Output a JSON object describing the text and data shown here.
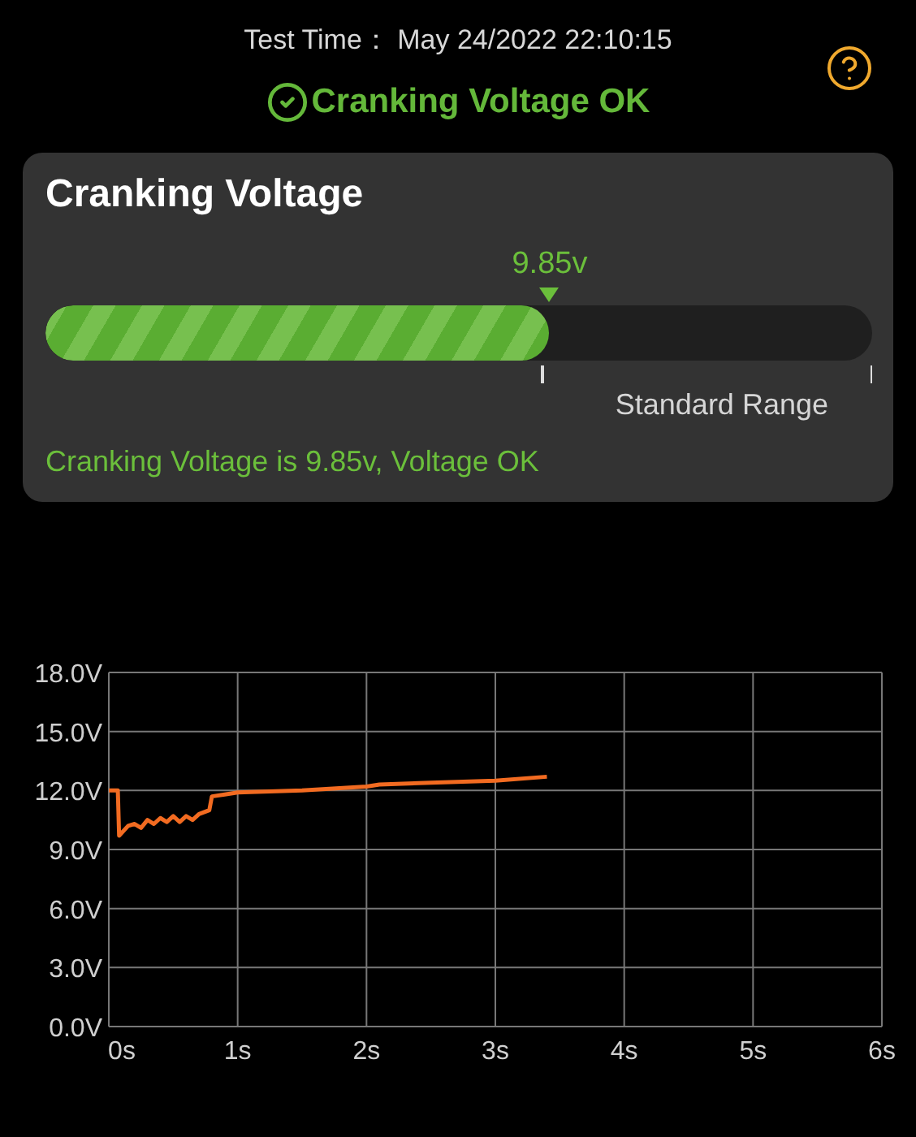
{
  "header": {
    "test_time": "Test Time： May 24/2022 22:10:15",
    "status": {
      "kind": "ok",
      "text": "Cranking Voltage OK"
    }
  },
  "card": {
    "title": "Cranking Voltage",
    "reading": "9.85v",
    "level": 0.61,
    "range_label": "Standard Range",
    "message": "Cranking Voltage is 9.85v, Voltage OK"
  },
  "chart": {
    "chart_data": {
      "type": "line",
      "grid": true,
      "xlim": [
        0,
        6
      ],
      "ylim": [
        0,
        18
      ],
      "xticks": [
        {
          "value": 0,
          "label": "0s"
        },
        {
          "value": 1,
          "label": "1s"
        },
        {
          "value": 2,
          "label": "2s"
        },
        {
          "value": 3,
          "label": "3s"
        },
        {
          "value": 4,
          "label": "4s"
        },
        {
          "value": 5,
          "label": "5s"
        },
        {
          "value": 6,
          "label": "6s"
        }
      ],
      "yticks": [
        {
          "value": 0,
          "label": "0.0V"
        },
        {
          "value": 3,
          "label": "3.0V"
        },
        {
          "value": 6,
          "label": "6.0V"
        },
        {
          "value": 9,
          "label": "9.0V"
        },
        {
          "value": 12,
          "label": "12.0V"
        },
        {
          "value": 15,
          "label": "15.0V"
        },
        {
          "value": 18,
          "label": "18.0V"
        }
      ],
      "x": [
        0,
        0.07,
        0.08,
        0.15,
        0.2,
        0.25,
        0.3,
        0.35,
        0.4,
        0.45,
        0.5,
        0.55,
        0.6,
        0.65,
        0.7,
        0.78,
        0.8,
        0.9,
        1.0,
        1.5,
        2.0,
        2.1,
        2.5,
        3.0,
        3.4
      ],
      "series": [
        {
          "color": "#f26b21",
          "values": [
            12.0,
            12.0,
            9.7,
            10.2,
            10.3,
            10.1,
            10.5,
            10.3,
            10.6,
            10.4,
            10.7,
            10.4,
            10.7,
            10.5,
            10.8,
            11.0,
            11.7,
            11.8,
            11.9,
            12.0,
            12.2,
            12.3,
            12.4,
            12.5,
            12.7
          ]
        }
      ]
    }
  }
}
